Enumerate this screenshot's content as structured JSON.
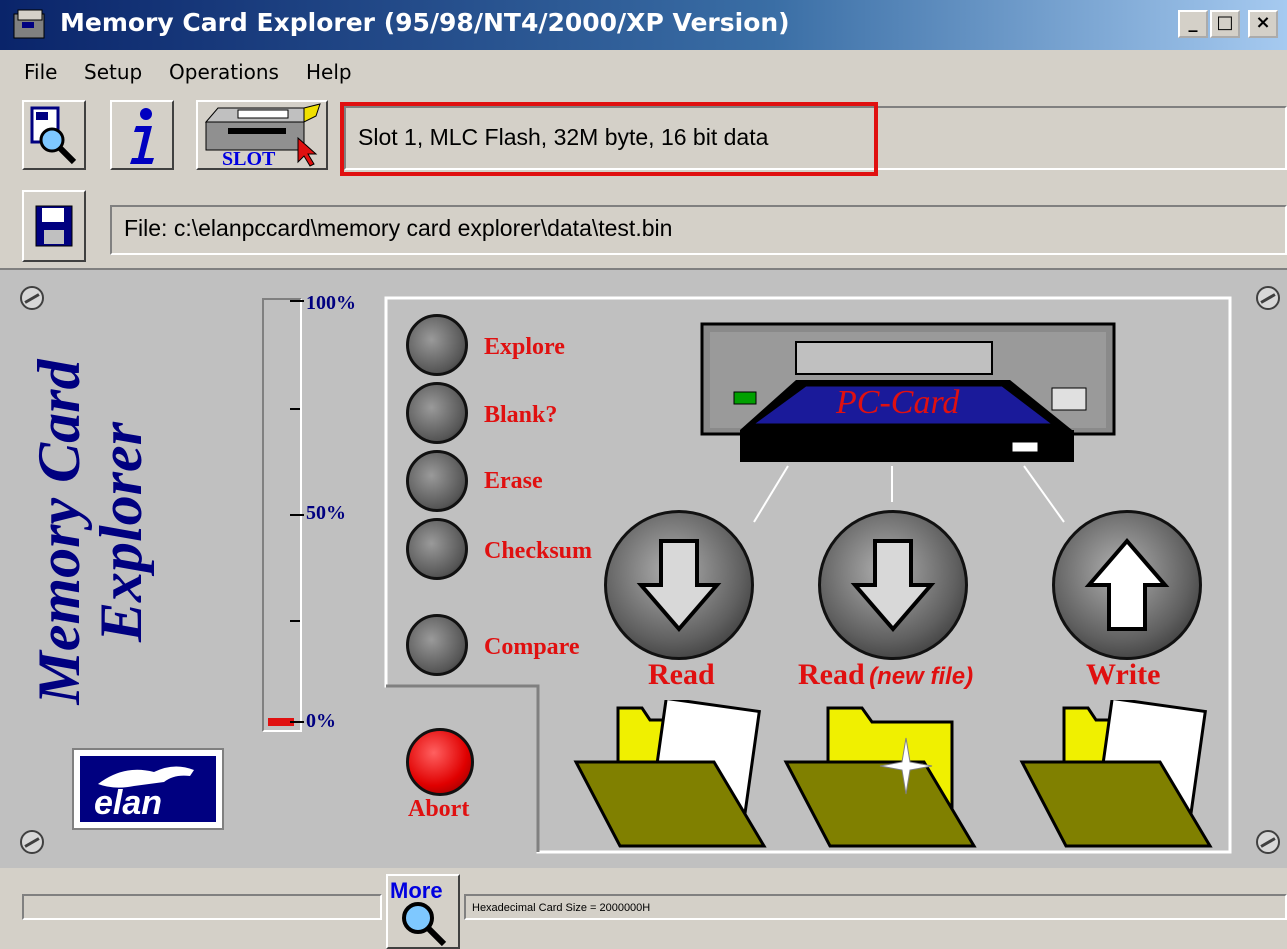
{
  "window": {
    "title": "Memory Card Explorer (95/98/NT4/2000/XP Version)",
    "minimize": "_",
    "maximize": "□",
    "close": "×"
  },
  "menu": {
    "items": [
      "File",
      "Setup",
      "Operations",
      "Help"
    ]
  },
  "toolbar": {
    "slot_status": "Slot 1, MLC Flash, 32M byte, 16 bit data",
    "slot_button_label": "SLOT",
    "file_path": "File: c:\\elanpccard\\memory card explorer\\data\\test.bin"
  },
  "logo": {
    "line1": "Memory Card",
    "line2": "Explorer",
    "brand": "elan"
  },
  "progress": {
    "label_top": "100%",
    "label_mid": "50%",
    "label_bottom": "0%",
    "fraction": 0.0
  },
  "operations": {
    "explore": "Explore",
    "blank": "Blank?",
    "erase": "Erase",
    "checksum": "Checksum",
    "compare": "Compare",
    "abort": "Abort"
  },
  "card": {
    "label": "PC-Card"
  },
  "actions": {
    "read": "Read",
    "read_new_prefix": "Read",
    "read_new_suffix": "(new file)",
    "write": "Write"
  },
  "status": {
    "more_label": "More",
    "card_size": "Hexadecimal Card Size = 2000000H"
  },
  "colors": {
    "accent_red": "#e01010",
    "navy": "#000080",
    "title_bar": "#0a246a",
    "folder": "#808000"
  }
}
